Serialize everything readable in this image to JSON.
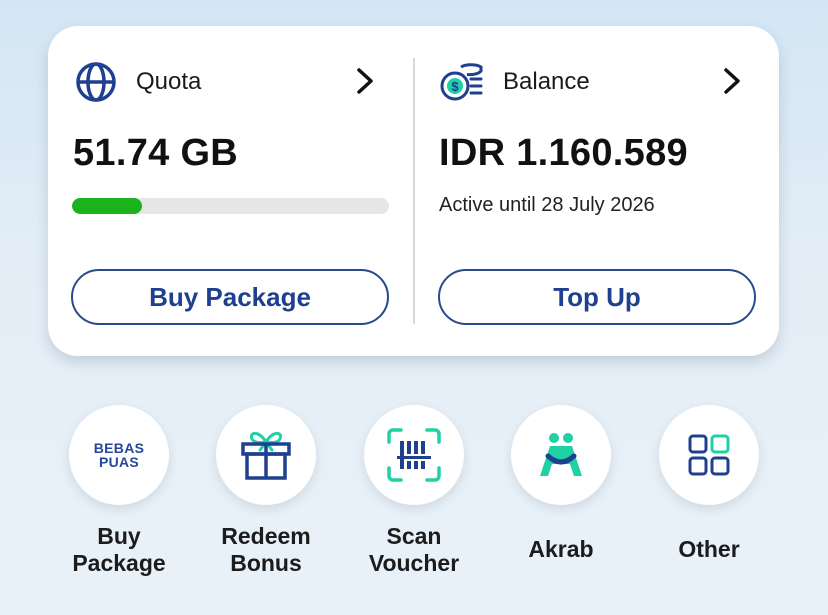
{
  "quota": {
    "title": "Quota",
    "value": "51.74 GB",
    "progress_fraction": 0.22,
    "progress_color": "#1cb21c",
    "button_label": "Buy Package",
    "icon": "globe-icon"
  },
  "balance": {
    "title": "Balance",
    "value": "IDR 1.160.589",
    "active_until": "Active until 28 July 2026",
    "button_label": "Top Up",
    "icon": "coins-icon"
  },
  "shortcuts": [
    {
      "label": "Buy\nPackage",
      "icon": "bebas-puas-logo",
      "logo_text": [
        "BEBAS",
        "PUAS"
      ]
    },
    {
      "label": "Redeem\nBonus",
      "icon": "gift-icon"
    },
    {
      "label": "Scan\nVoucher",
      "icon": "barcode-scan-icon"
    },
    {
      "label": "Akrab",
      "icon": "akrab-icon"
    },
    {
      "label": "Other",
      "icon": "grid-icon"
    }
  ],
  "colors": {
    "brand_blue": "#1f3f8f",
    "accent_teal": "#1fd1a5",
    "progress_green": "#1cb21c"
  }
}
